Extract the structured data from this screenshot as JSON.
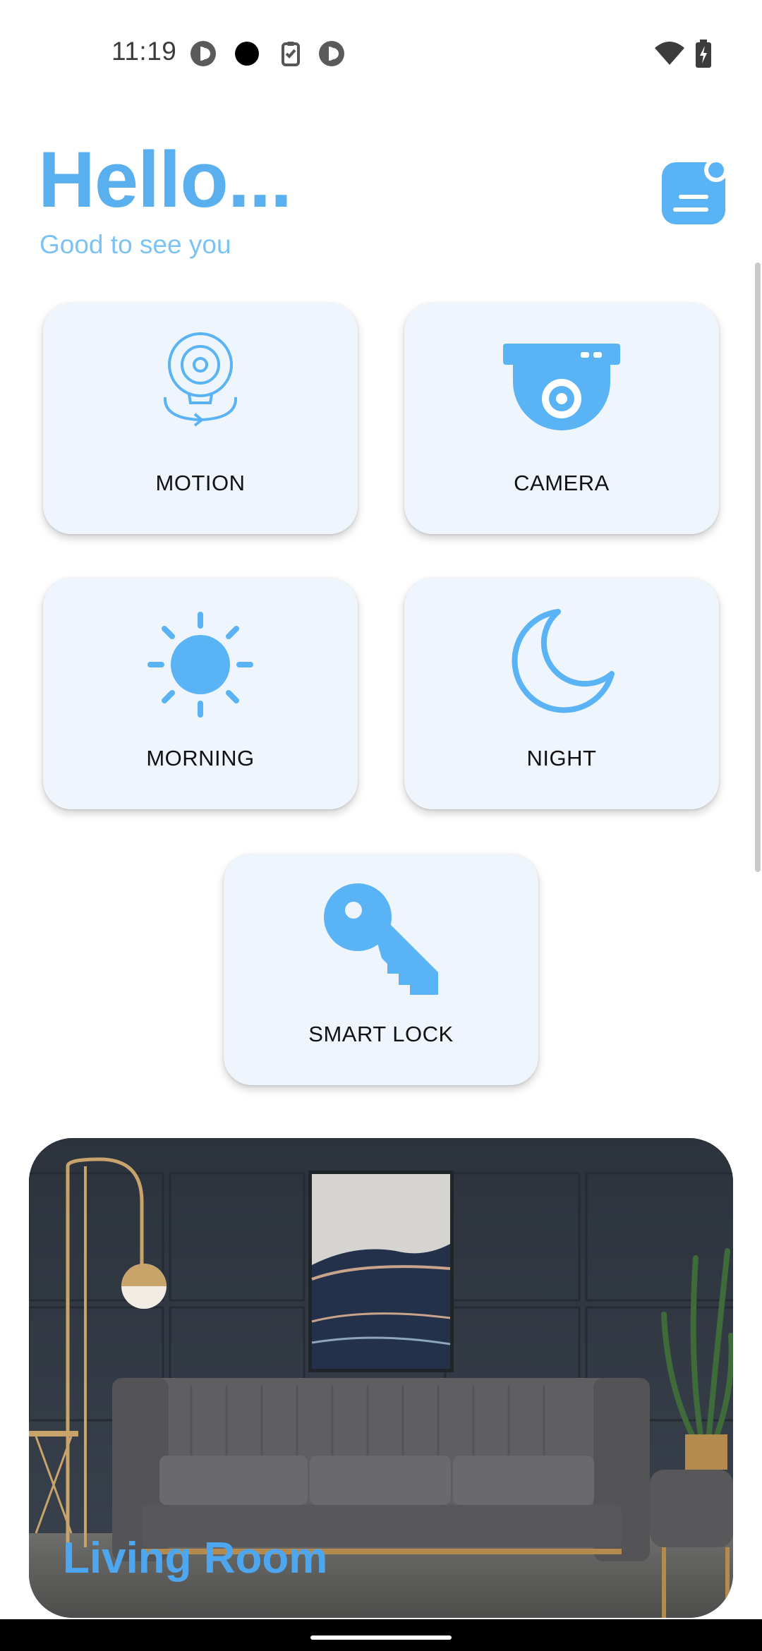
{
  "status_bar": {
    "time": "11:19",
    "left_icons": [
      "pocket-casts-icon",
      "dot-icon",
      "clipboard-check-icon",
      "pocket-casts-icon"
    ],
    "right_icons": [
      "wifi-icon",
      "battery-charging-icon"
    ]
  },
  "header": {
    "greeting": "Hello...",
    "subtitle": "Good to see you",
    "menu_icon": "menu-icon"
  },
  "tiles": [
    {
      "label": "MOTION",
      "icon": "webcam-icon"
    },
    {
      "label": "CAMERA",
      "icon": "security-camera-icon"
    },
    {
      "label": "MORNING",
      "icon": "sun-icon"
    },
    {
      "label": "NIGHT",
      "icon": "moon-icon"
    },
    {
      "label": "SMART LOCK",
      "icon": "key-icon"
    }
  ],
  "room_card": {
    "title": "Living Room",
    "image": "living-room-photo"
  },
  "colors": {
    "accent": "#5aafee",
    "tile_bg": "#eef5fd",
    "subtitle": "#7cc2f2"
  }
}
